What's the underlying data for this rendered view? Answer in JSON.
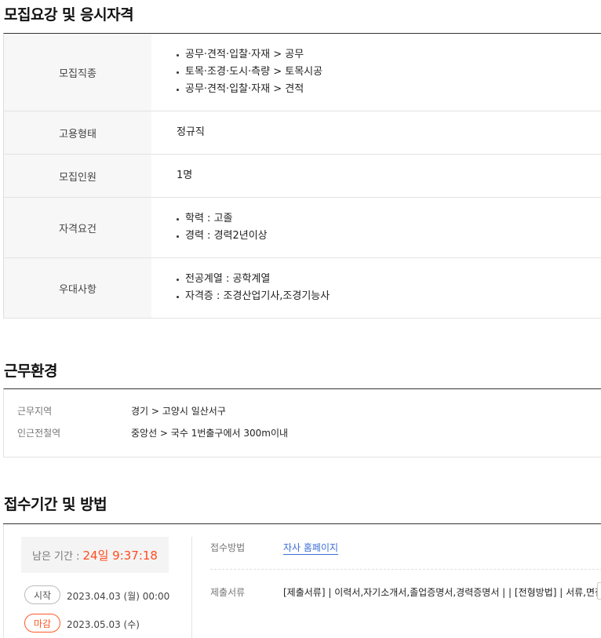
{
  "sections": {
    "recruit": "모집요강 및 응시자격",
    "environment": "근무환경",
    "apply": "접수기간 및 방법"
  },
  "requirements": {
    "job_type": {
      "label": "모집직종",
      "items": [
        "공무·견적·입찰·자재 > 공무",
        "토목·조경·도시·측량 > 토목시공",
        "공무·견적·입찰·자재 > 견적"
      ]
    },
    "employment": {
      "label": "고용형태",
      "value": "정규직"
    },
    "headcount": {
      "label": "모집인원",
      "value": "1명"
    },
    "qualification": {
      "label": "자격요건",
      "items": [
        "학력 : 고졸",
        "경력 : 경력2년이상"
      ]
    },
    "preference": {
      "label": "우대사항",
      "items": [
        "전공계열 : 공학계열",
        "자격증 : 조경산업기사,조경기능사"
      ]
    }
  },
  "environment": {
    "location": {
      "label": "근무지역",
      "value": "경기 > 고양시 일산서구"
    },
    "station": {
      "label": "인근전철역",
      "value": "중앙선 > 국수 1번출구에서 300m이내"
    }
  },
  "apply": {
    "remaining_label": "남은 기간 :",
    "remaining_value": "24일 9:37:18",
    "start_label": "시작",
    "start_date": "2023.04.03 (월) 00:00",
    "end_label": "마감",
    "end_date": "2023.05.03 (수)",
    "method_label": "접수방법",
    "method_value": "자사 홈페이지",
    "docs_label": "제출서류",
    "docs_value": "[제출서류] | 이력서,자기소개서,졸업증명서,경력증명서 | | [전형방법] | 서류,면접"
  }
}
